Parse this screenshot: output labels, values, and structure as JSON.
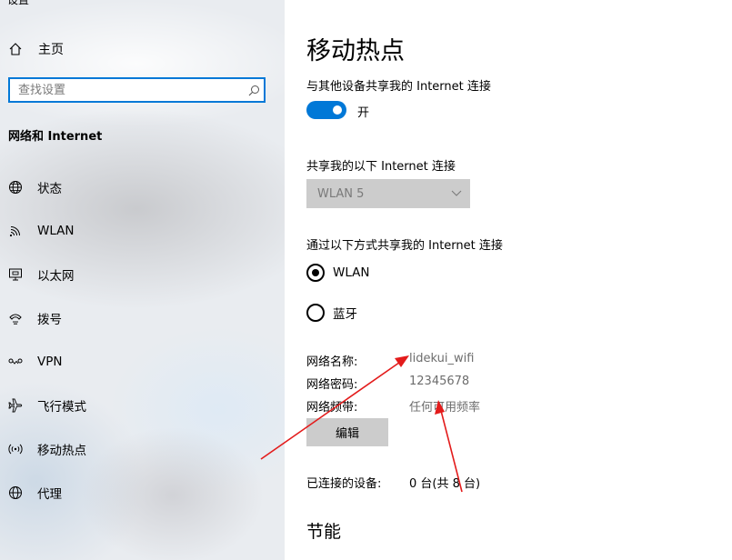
{
  "window": {
    "title": "设置"
  },
  "sidebar": {
    "home_label": "主页",
    "search": {
      "placeholder": "查找设置",
      "icon": "search-icon"
    },
    "section_title": "网络和 Internet",
    "items": [
      {
        "label": "状态",
        "icon": "globe-status-icon"
      },
      {
        "label": "WLAN",
        "icon": "wifi-icon"
      },
      {
        "label": "以太网",
        "icon": "ethernet-icon"
      },
      {
        "label": "拨号",
        "icon": "dialup-icon"
      },
      {
        "label": "VPN",
        "icon": "vpn-icon"
      },
      {
        "label": "飞行模式",
        "icon": "airplane-icon"
      },
      {
        "label": "移动热点",
        "icon": "hotspot-icon"
      },
      {
        "label": "代理",
        "icon": "globe-icon"
      }
    ]
  },
  "main": {
    "title": "移动热点",
    "share_label": "与其他设备共享我的 Internet 连接",
    "toggle": {
      "state": "开",
      "on": true
    },
    "share_from_label": "共享我的以下 Internet 连接",
    "share_from_value": "WLAN 5",
    "share_over_label": "通过以下方式共享我的 Internet 连接",
    "share_over_options": [
      {
        "label": "WLAN",
        "checked": true
      },
      {
        "label": "蓝牙",
        "checked": false
      }
    ],
    "props": {
      "name_label": "网络名称:",
      "name_value": "lidekui_wifi",
      "password_label": "网络密码:",
      "password_value": "12345678",
      "band_label": "网络频带:",
      "band_value": "任何可用频率"
    },
    "edit_label": "编辑",
    "connected_label": "已连接的设备:",
    "connected_value": "0 台(共 8 台)",
    "power_saving_title": "节能"
  },
  "colors": {
    "accent": "#0078d7",
    "annotation": "#e31b1b",
    "disabled_bg": "#cccccc"
  }
}
